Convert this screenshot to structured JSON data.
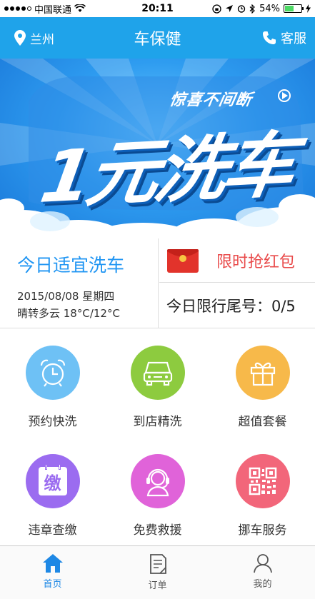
{
  "status_bar": {
    "carrier": "中国联通",
    "time": "20:11",
    "battery_percent": "54%",
    "battery_level": 0.54
  },
  "nav": {
    "city": "兰州",
    "title": "车保健",
    "service": "客服"
  },
  "banner": {
    "subtitle": "惊喜不间断",
    "headline": "1元洗车"
  },
  "info": {
    "wash_title": "今日适宜洗车",
    "date": "2015/08/08 星期四",
    "weather": "晴转多云  18°C/12°C",
    "red_packet_label": "限时抢红包",
    "plate_restriction": "今日限行尾号：0/5"
  },
  "services": [
    {
      "label": "预约快洗",
      "icon": "alarm-clock-icon",
      "color": "#6ec1f5"
    },
    {
      "label": "到店精洗",
      "icon": "car-icon",
      "color": "#8dcb3f"
    },
    {
      "label": "超值套餐",
      "icon": "gift-icon",
      "color": "#f7b94a"
    },
    {
      "label": "违章查缴",
      "icon": "fine-calendar-icon",
      "color": "#9b6cf0"
    },
    {
      "label": "免费救援",
      "icon": "headset-icon",
      "color": "#e063d9"
    },
    {
      "label": "挪车服务",
      "icon": "qr-code-icon",
      "color": "#f2667a"
    }
  ],
  "fine_icon_char": "缴",
  "tabs": [
    {
      "label": "首页",
      "icon": "home-icon",
      "active": true
    },
    {
      "label": "订单",
      "icon": "order-icon",
      "active": false
    },
    {
      "label": "我的",
      "icon": "profile-icon",
      "active": false
    }
  ],
  "colors": {
    "accent": "#1fa3ea",
    "wash_title": "#2196f3",
    "red_packet": "#e94b4b"
  }
}
